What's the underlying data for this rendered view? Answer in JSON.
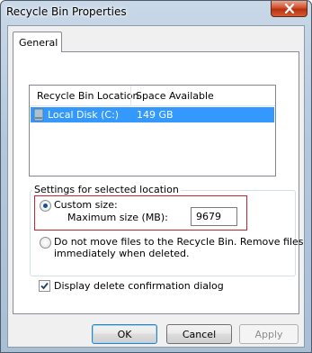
{
  "window": {
    "title": "Recycle Bin Properties"
  },
  "tabs": [
    {
      "label": "General"
    }
  ],
  "locations": {
    "columns": [
      "Recycle Bin Location",
      "Space Available"
    ],
    "rows": [
      {
        "location": "Local Disk (C:)",
        "space": "149 GB",
        "icon": "drive-icon",
        "selected": true
      }
    ]
  },
  "settings": {
    "group_label": "Settings for selected location",
    "custom_size_label": "Custom size:",
    "max_size_label": "Maximum size (MB):",
    "max_size_value": "9679",
    "no_move_label_line1": "Do not move files to the Recycle Bin. Remove files",
    "no_move_label_line2": "immediately when deleted."
  },
  "confirm": {
    "label": "Display delete confirmation dialog",
    "checked": true
  },
  "buttons": {
    "ok": "OK",
    "cancel": "Cancel",
    "apply": "Apply"
  },
  "colors": {
    "selection": "#3399ff",
    "highlight_border": "#c8242b",
    "close": "#c63c17"
  }
}
